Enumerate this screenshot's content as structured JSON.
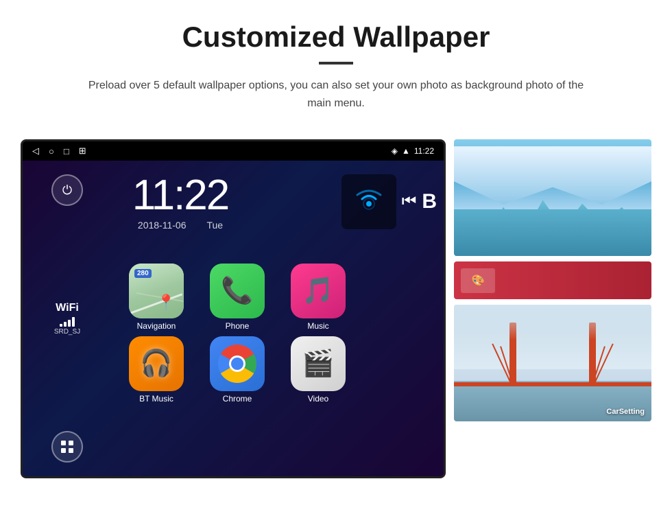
{
  "header": {
    "title": "Customized Wallpaper",
    "subtitle": "Preload over 5 default wallpaper options, you can also set your own photo as background photo of the main menu."
  },
  "device": {
    "status_bar": {
      "time": "11:22",
      "nav_icons": [
        "◁",
        "○",
        "□",
        "⊞"
      ],
      "right_icons": [
        "location",
        "wifi",
        "signal"
      ]
    },
    "clock": {
      "time": "11:22",
      "date": "2018-11-06",
      "day": "Tue"
    },
    "wifi": {
      "label": "WiFi",
      "ssid": "SRD_SJ"
    },
    "apps": [
      {
        "name": "Navigation",
        "type": "navigation",
        "badge": "280"
      },
      {
        "name": "Phone",
        "type": "phone"
      },
      {
        "name": "Music",
        "type": "music"
      },
      {
        "name": "BT Music",
        "type": "btmusic"
      },
      {
        "name": "Chrome",
        "type": "chrome"
      },
      {
        "name": "Video",
        "type": "video"
      }
    ]
  },
  "wallpapers": [
    {
      "name": "Ice Cave",
      "type": "ice"
    },
    {
      "name": "Golden Gate Bridge",
      "type": "bridge"
    },
    {
      "name": "CarSetting",
      "type": "carsetting"
    }
  ],
  "sidebar": {
    "power_label": "⏻",
    "grid_label": "⊞"
  }
}
